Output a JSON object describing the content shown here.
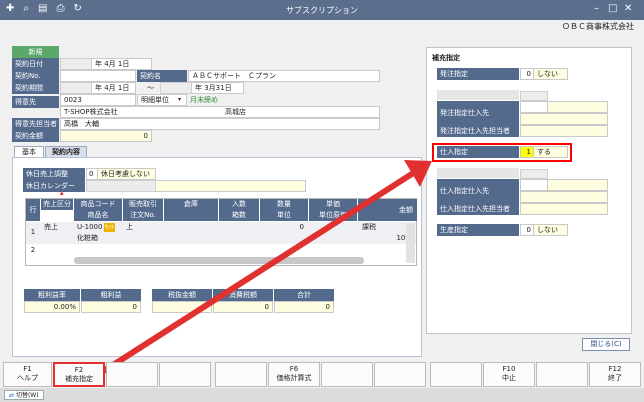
{
  "window": {
    "title": "サブスクリプション",
    "company": "ＯＢＣ商事株式会社"
  },
  "header": {
    "badge": "新規",
    "contract_date_label": "契約日付",
    "contract_date": "年  4月  1日",
    "contract_no_label": "契約No.",
    "contract_name_label": "契約名",
    "contract_name": "ＡＢＣサポート　Ｃプラン",
    "period_label": "契約期間",
    "period_start": "年  4月  1日",
    "period_tilde": "〜",
    "period_end": "年  3月31日",
    "customer_label": "得意先",
    "customer_code": "0023",
    "detail_unit": "明細単位",
    "month_end_label": "月末締め",
    "customer_name": "T-SHOP株式会社",
    "branch": "高城店",
    "contact_label": "得意先担当者",
    "contact_name": "高橋　大輔",
    "amount_label": "契約金額",
    "amount": "0"
  },
  "tabs": [
    "基本",
    "契約内容"
  ],
  "contract": {
    "holiday_adjust_label": "休日売上調整",
    "holiday_adjust_code": "0",
    "holiday_adjust_value": "休日考慮しない",
    "holiday_calendar_label": "休日カレンダー"
  },
  "grid": {
    "h_row": "行",
    "h_sales_type": "売上区分",
    "h_item_code": "商品コード",
    "h_item_name": "商品名",
    "h_sales_deal": "販売取引",
    "h_order_no": "注文No.",
    "h_warehouse": "倉庫",
    "h_qty_in": "入数",
    "h_boxes": "箱数",
    "h_qty": "数量",
    "h_unit": "単位",
    "h_price": "単価",
    "h_price_note": "単位原価",
    "h_amount": "金額",
    "rows": [
      {
        "no": "1",
        "sales_type": "売上",
        "item_code": "U-1000",
        "item_badge": "ｾｯﾄ",
        "item_name": "化粧箱",
        "sales_deal": "上",
        "qty": "0",
        "tax": "課税",
        "rate": "10%"
      },
      {
        "no": "2"
      }
    ]
  },
  "summary": {
    "gross_rate_label": "粗利益率",
    "gross_rate": "0.00%",
    "gross_label": "粗利益",
    "gross": "0",
    "ex_tax_label": "税抜金額",
    "ex_tax": "0",
    "tax_label": "消費税額",
    "tax": "0",
    "total_label": "合計",
    "total": "0"
  },
  "supplement": {
    "title": "補充指定",
    "order_label": "発注指定",
    "order_code": "0",
    "order_value": "しない",
    "order_supplier_label": "発注指定仕入先",
    "order_contact_label": "発注指定仕入先担当者",
    "purchase_label": "仕入指定",
    "purchase_code": "1",
    "purchase_value": "する",
    "purchase_supplier_label": "仕入指定仕入先",
    "purchase_contact_label": "仕入指定仕入先担当者",
    "production_label": "生産指定",
    "production_code": "0",
    "production_value": "しない"
  },
  "close_button": "閉じる(C)",
  "fkeys": [
    {
      "key": "F1",
      "label": "ヘルプ"
    },
    {
      "key": "F2",
      "label": "補充指定"
    },
    {
      "key": "",
      "label": ""
    },
    {
      "key": "",
      "label": ""
    },
    {
      "key": "",
      "label": ""
    },
    {
      "key": "F6",
      "label": "価格計算式"
    },
    {
      "key": "",
      "label": ""
    },
    {
      "key": "",
      "label": ""
    },
    {
      "key": "",
      "label": ""
    },
    {
      "key": "F10",
      "label": "中止"
    },
    {
      "key": "",
      "label": ""
    },
    {
      "key": "F12",
      "label": "終了"
    }
  ],
  "status": {
    "switch_label": "切替(W)"
  },
  "colors": {
    "titlebar": "#5b6e8c",
    "label_bg": "#536a8d",
    "new_badge": "#5aa96a",
    "highlight": "#ff0000",
    "arrow": "#e03030"
  }
}
